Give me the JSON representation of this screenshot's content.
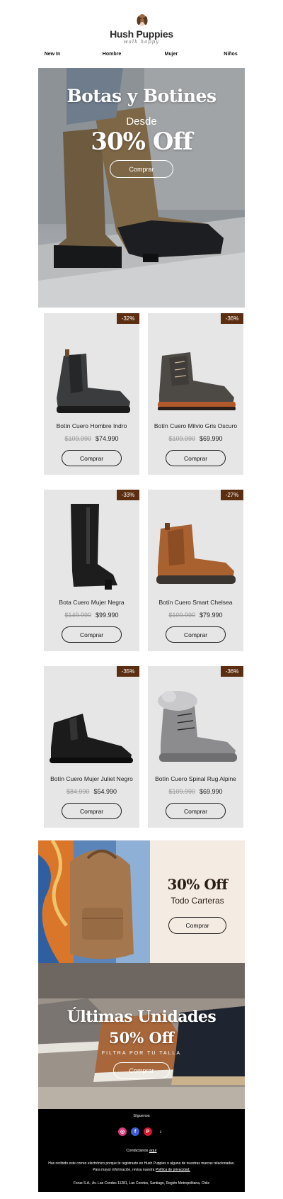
{
  "brand": {
    "name": "Hush Puppies",
    "tagline": "walk happy"
  },
  "nav": [
    "New In",
    "Hombre",
    "Mujer",
    "Niños"
  ],
  "hero": {
    "title": "Botas y Botines",
    "desde": "Desde",
    "offer": "30% Off",
    "button": "Comprar"
  },
  "products": [
    {
      "badge": "-32%",
      "name": "Botín Cuero Hombre Indro",
      "old_price": "$109.990",
      "price": "$74.990",
      "button": "Comprar",
      "icon": "chelsea-boot-dark"
    },
    {
      "badge": "-36%",
      "name": "Botín Cuero Milvio Gris Oscuro",
      "old_price": "$109.990",
      "price": "$69.990",
      "button": "Comprar",
      "icon": "lace-boot-grey"
    },
    {
      "badge": "-33%",
      "name": "Bota Cuero Mujer Negra",
      "old_price": "$149.990",
      "price": "$99.990",
      "button": "Comprar",
      "icon": "tall-boot-black"
    },
    {
      "badge": "-27%",
      "name": "Botín Cuero Smart Chelsea",
      "old_price": "$109.990",
      "price": "$79.990",
      "button": "Comprar",
      "icon": "chelsea-boot-tan"
    },
    {
      "badge": "-35%",
      "name": "Botín Cuero Mujer Juliet Negro",
      "old_price": "$84.990",
      "price": "$54.990",
      "button": "Comprar",
      "icon": "ankle-boot-black"
    },
    {
      "badge": "-36%",
      "name": "Botín Cuero Spinal Rug Alpine",
      "old_price": "$109.990",
      "price": "$69.990",
      "button": "Comprar",
      "icon": "fur-boot-grey"
    }
  ],
  "promo": {
    "offer": "30% Off",
    "subtitle": "Todo Carteras",
    "button": "Comprar"
  },
  "ultimas": {
    "title": "Últimas Unidades",
    "offer": "50% Off",
    "subtitle": "FILTRA POR TU TALLA",
    "button": "Comprar"
  },
  "footer": {
    "follow": "Síguenos",
    "socials": [
      "instagram-icon",
      "facebook-icon",
      "pinterest-icon",
      "tiktok-icon"
    ],
    "contact_prefix": "Contáctanos",
    "contact_link": "aquí",
    "legal_1": "Has recibido este correo electrónico porque te registraste en Hush Puppies o alguna de nuestras marcas relacionadas.",
    "legal_2_prefix": "Para mayor información, revisa nuestra",
    "legal_2_link": "Política de privacidad.",
    "address": "Forus S.A., Av. Las Condes 11281, Las Condes, Santiago, Región Metropolitana, Chile"
  },
  "colors": {
    "badge": "#5c2e11",
    "card": "#e6e6e6",
    "promo_bg": "#f4ebe2",
    "footer": "#000000"
  }
}
